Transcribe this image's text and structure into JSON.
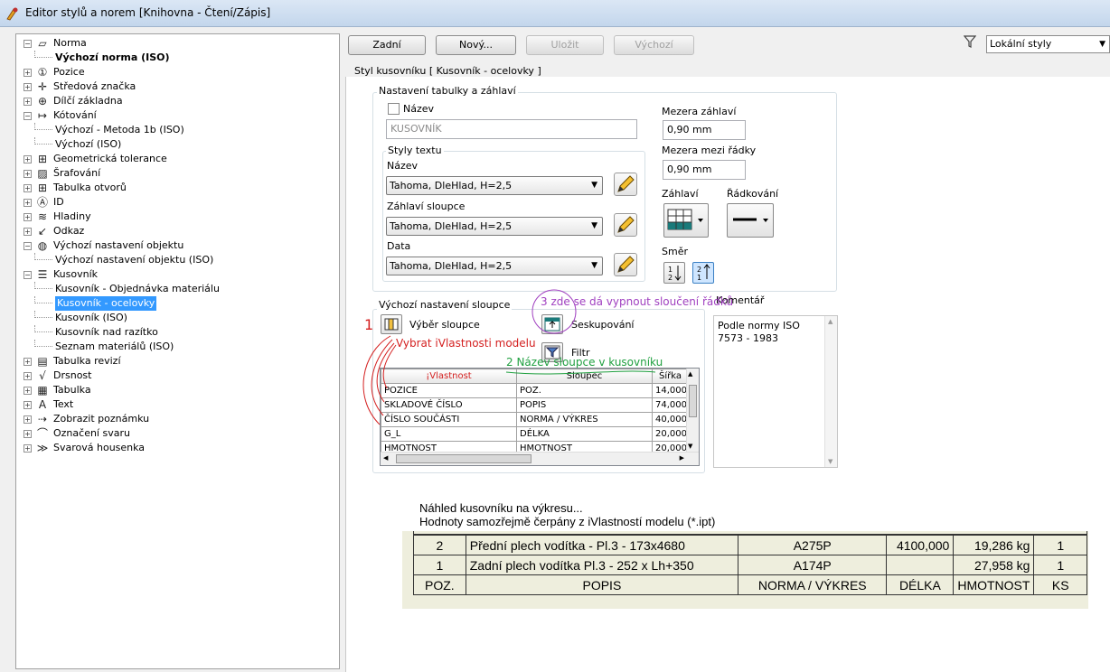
{
  "window": {
    "title": "Editor stylů a norem [Knihovna - Čtení/Zápis]"
  },
  "tree": {
    "items": [
      {
        "label": "Norma",
        "icon": "norma-icon",
        "expander": "−",
        "level": 0
      },
      {
        "label": "Výchozí norma (ISO)",
        "level": 1,
        "bold": true
      },
      {
        "label": "Pozice",
        "icon": "balloon-icon",
        "expander": "+",
        "level": 0
      },
      {
        "label": "Středová značka",
        "icon": "center-mark-icon",
        "expander": "+",
        "level": 0
      },
      {
        "label": "Dílčí základna",
        "icon": "datum-icon",
        "expander": "+",
        "level": 0
      },
      {
        "label": "Kótování",
        "icon": "dimension-icon",
        "expander": "−",
        "level": 0
      },
      {
        "label": "Výchozí - Metoda 1b (ISO)",
        "level": 1
      },
      {
        "label": "Výchozí (ISO)",
        "level": 1
      },
      {
        "label": "Geometrická tolerance",
        "icon": "tolerance-icon",
        "expander": "+",
        "level": 0
      },
      {
        "label": "Šrafování",
        "icon": "hatch-icon",
        "expander": "+",
        "level": 0
      },
      {
        "label": "Tabulka otvorů",
        "icon": "hole-table-icon",
        "expander": "+",
        "level": 0
      },
      {
        "label": "ID",
        "icon": "id-icon",
        "expander": "+",
        "level": 0
      },
      {
        "label": "Hladiny",
        "icon": "layers-icon",
        "expander": "+",
        "level": 0
      },
      {
        "label": "Odkaz",
        "icon": "leader-icon",
        "expander": "+",
        "level": 0
      },
      {
        "label": "Výchozí nastavení objektu",
        "icon": "globe-icon",
        "expander": "−",
        "level": 0
      },
      {
        "label": "Výchozí nastavení objektu (ISO)",
        "level": 1
      },
      {
        "label": "Kusovník",
        "icon": "parts-list-icon",
        "expander": "−",
        "level": 0
      },
      {
        "label": "Kusovník - Objednávka materiálu",
        "level": 1
      },
      {
        "label": "Kusovník - ocelovky",
        "level": 1,
        "selected": true
      },
      {
        "label": "Kusovník (ISO)",
        "level": 1
      },
      {
        "label": "Kusovník nad razítko",
        "level": 1
      },
      {
        "label": "Seznam materiálů (ISO)",
        "level": 1
      },
      {
        "label": "Tabulka revizí",
        "icon": "revision-table-icon",
        "expander": "+",
        "level": 0
      },
      {
        "label": "Drsnost",
        "icon": "surface-texture-icon",
        "expander": "+",
        "level": 0
      },
      {
        "label": "Tabulka",
        "icon": "table-icon",
        "expander": "+",
        "level": 0
      },
      {
        "label": "Text",
        "icon": "text-icon",
        "expander": "+",
        "level": 0
      },
      {
        "label": "Zobrazit poznámku",
        "icon": "view-annotation-icon",
        "expander": "+",
        "level": 0
      },
      {
        "label": "Označení svaru",
        "icon": "weld-symbol-icon",
        "expander": "+",
        "level": 0
      },
      {
        "label": "Svarová housenka",
        "icon": "weld-bead-icon",
        "expander": "+",
        "level": 0
      }
    ]
  },
  "toolbar": {
    "back": "Zadní",
    "new": "Nový...",
    "save": "Uložit",
    "default": "Výchozí",
    "filter_value": "Lokální styly"
  },
  "style": {
    "heading": "Styl kusovníku [ Kusovník - ocelovky ]",
    "table_settings": {
      "group_label": "Nastavení tabulky a záhlaví",
      "name_checkbox_label": "Název",
      "name_value": "KUSOVNÍK",
      "text_styles_label": "Styly textu",
      "name_style_label": "Název",
      "name_style_value": "Tahoma, DleHlad, H=2,5",
      "column_header_label": "Záhlaví sloupce",
      "column_header_value": "Tahoma, DleHlad, H=2,5",
      "data_label": "Data",
      "data_value": "Tahoma, DleHlad, H=2,5",
      "header_gap_label": "Mezera záhlaví",
      "header_gap_value": "0,90 mm",
      "line_gap_label": "Mezera mezi řádky",
      "line_gap_value": "0,90 mm",
      "header_label": "Záhlaví",
      "line_spacing_label": "Řádkování",
      "direction_label": "Směr"
    },
    "column_defaults": {
      "group_label": "Výchozí nastavení sloupce",
      "column_chooser": "Výběr sloupce",
      "grouping": "Seskupování",
      "filter": "Filtr",
      "headers": [
        "¡Vlastnost",
        "Sloupec",
        "Šířka"
      ],
      "rows": [
        [
          "POZICE",
          "POZ.",
          "14,000"
        ],
        [
          "SKLADOVÉ ČÍSLO",
          "POPIS",
          "74,000"
        ],
        [
          "ČÍSLO SOUČÁSTI",
          "NORMA / VÝKRES",
          "40,000"
        ],
        [
          "G_L",
          "DÉLKA",
          "20,000"
        ],
        [
          "HMOTNOST",
          "HMOTNOST",
          "20,000"
        ]
      ]
    },
    "comment": {
      "label": "Komentář",
      "value": "Podle normy ISO 7573 - 1983"
    }
  },
  "annotations": {
    "num1": "1",
    "text1": "Vybrat iVlastnosti modelu",
    "text2": "2 Název sloupce v kusovníku",
    "text3": "3 zde se dá vypnout sloučení řádků",
    "preview_line1": "Náhled kusovníku na výkresu...",
    "preview_line2": "Hodnoty samozřejmě čerpány z iVlastností modelu (*.ipt)"
  },
  "preview_table": {
    "rows": [
      [
        "2",
        "Přední plech vodítka - Pl.3 - 173x4680",
        "A275P",
        "4100,000",
        "19,286 kg",
        "1"
      ],
      [
        "1",
        "Zadní plech vodítka Pl.3 - 252 x Lh+350",
        "A174P",
        "",
        "27,958 kg",
        "1"
      ]
    ],
    "headers": [
      "POZ.",
      "POPIS",
      "NORMA / VÝKRES",
      "DÉLKA",
      "HMOTNOST",
      "KS"
    ]
  },
  "colors": {
    "annotation_red": "#d42020",
    "annotation_green": "#20a040",
    "annotation_purple": "#a040c0",
    "selection": "#3399ff",
    "preview_bg": "#eeeedd"
  }
}
